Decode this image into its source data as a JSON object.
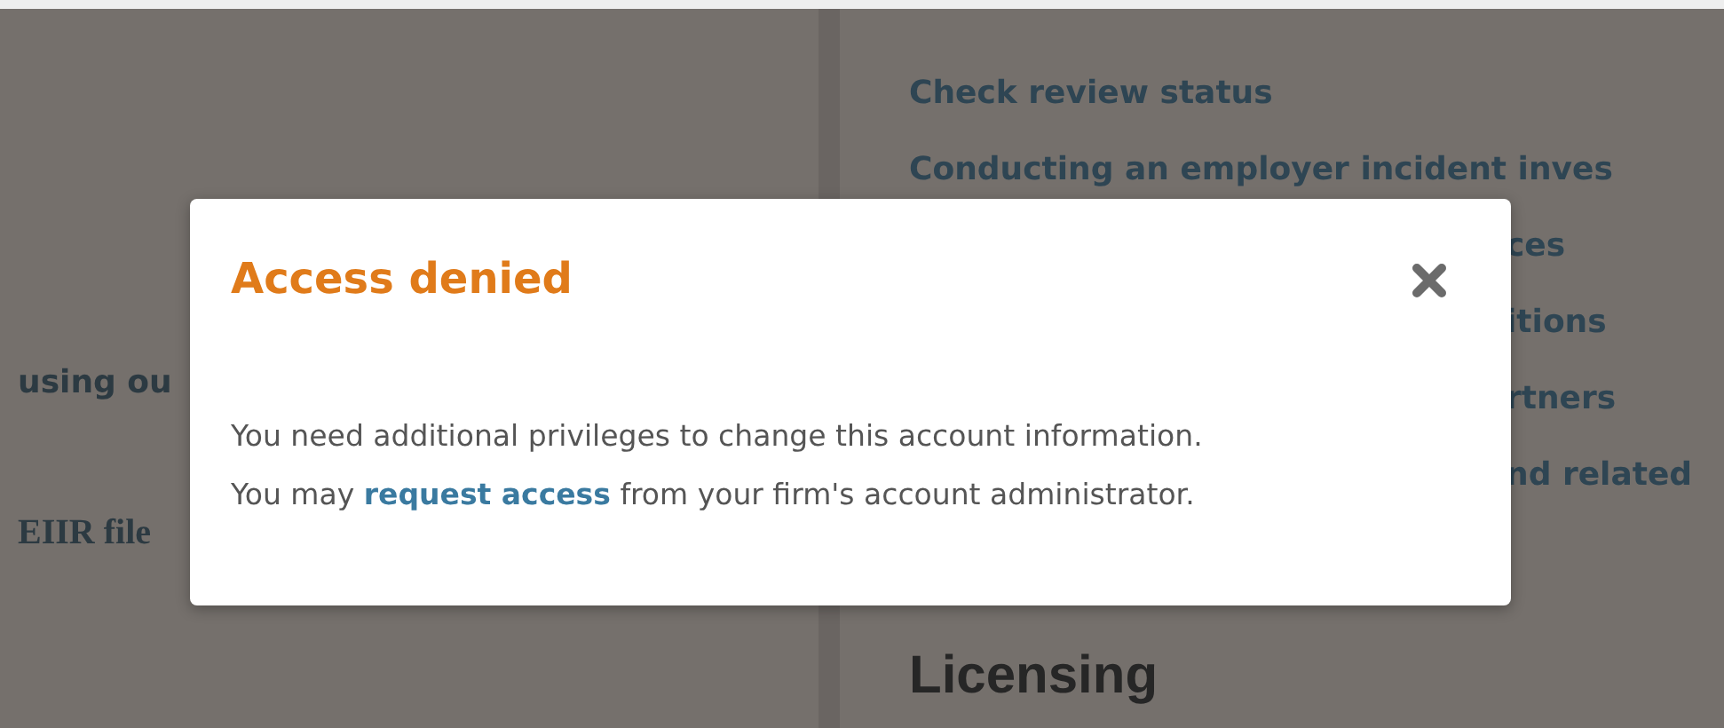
{
  "background": {
    "left_column": [
      {
        "text": "using ou",
        "kind": "sans"
      },
      {
        "text": "EIIR file",
        "kind": "serif"
      }
    ],
    "resource_links": [
      {
        "text": "Check review status",
        "kind": "full"
      },
      {
        "text": "Conducting an employer incident inves",
        "kind": "full"
      },
      {
        "text": "ces",
        "kind": "covered"
      },
      {
        "text": "itions",
        "kind": "covered"
      },
      {
        "text": "rtners",
        "kind": "covered"
      },
      {
        "text": "nd related",
        "kind": "covered"
      }
    ],
    "licensing_heading": "Licensing"
  },
  "dialog": {
    "title": "Access denied",
    "message": {
      "sentence_1": "You need additional privileges to change this account information.",
      "before_link": "You may ",
      "link": "request access",
      "after_link": " from your firm's account administrator."
    }
  }
}
